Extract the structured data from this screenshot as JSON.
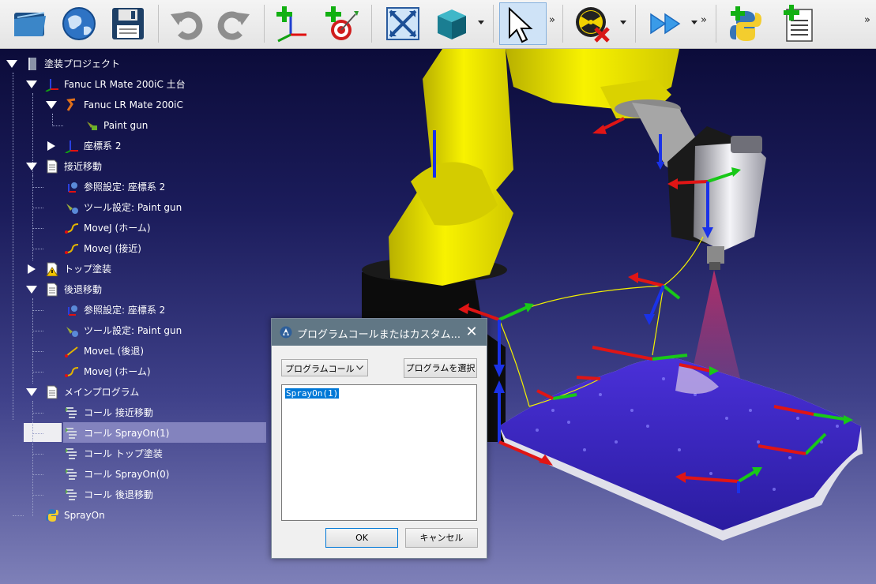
{
  "toolbar": {
    "icons": [
      "open-folder-icon",
      "globe-icon",
      "save-icon",
      "undo-icon",
      "redo-icon",
      "add-reference-frame-icon",
      "add-target-icon",
      "fit-all-icon",
      "view-cube-icon",
      "select-cursor-icon",
      "collision-check-icon",
      "run-simulation-icon",
      "add-python-script-icon",
      "add-program-icon"
    ],
    "overflow": "»"
  },
  "tree": {
    "items": [
      {
        "label": "塗装プロジェクト",
        "icon": "station-icon"
      },
      {
        "label": "Fanuc LR Mate 200iC 土台",
        "icon": "frame-icon"
      },
      {
        "label": "Fanuc LR Mate 200iC",
        "icon": "robot-icon"
      },
      {
        "label": "Paint gun",
        "icon": "tool-icon"
      },
      {
        "label": "座標系 2",
        "icon": "frame-icon"
      },
      {
        "label": "接近移動",
        "icon": "program-icon"
      },
      {
        "label": "参照設定: 座標系 2",
        "icon": "set-reference-icon"
      },
      {
        "label": "ツール設定: Paint gun",
        "icon": "set-tool-icon"
      },
      {
        "label": "MoveJ (ホーム)",
        "icon": "movej-icon"
      },
      {
        "label": "MoveJ (接近)",
        "icon": "movej-icon"
      },
      {
        "label": "トップ塗装",
        "icon": "program-warning-icon"
      },
      {
        "label": "後退移動",
        "icon": "program-icon"
      },
      {
        "label": "参照設定: 座標系 2",
        "icon": "set-reference-icon"
      },
      {
        "label": "ツール設定: Paint gun",
        "icon": "set-tool-icon"
      },
      {
        "label": "MoveL (後退)",
        "icon": "movel-icon"
      },
      {
        "label": "MoveJ (ホーム)",
        "icon": "movej-icon"
      },
      {
        "label": "メインプログラム",
        "icon": "program-icon"
      },
      {
        "label": "コール 接近移動",
        "icon": "program-call-icon"
      },
      {
        "label": "コール SprayOn(1)",
        "icon": "program-call-icon"
      },
      {
        "label": "コール トップ塗装",
        "icon": "program-call-icon"
      },
      {
        "label": "コール SprayOn(0)",
        "icon": "program-call-icon"
      },
      {
        "label": "コール 後退移動",
        "icon": "program-call-icon"
      },
      {
        "label": "SprayOn",
        "icon": "python-icon"
      }
    ]
  },
  "dialog": {
    "title": "プログラムコールまたはカスタム...",
    "close": "✕",
    "combo_value": "プログラムコール",
    "select_button": "プログラムを選択",
    "text_value": "SprayOn(1)",
    "ok_label": "OK",
    "cancel_label": "キャンセル"
  },
  "colors": {
    "toolbar_bg": "#eeeeee",
    "viewport_top": "#0c0c3a",
    "viewport_bottom": "#7e80b8",
    "selection": "#8383be",
    "dialog_title": "#617785",
    "robot_yellow": "#f4ee00"
  }
}
